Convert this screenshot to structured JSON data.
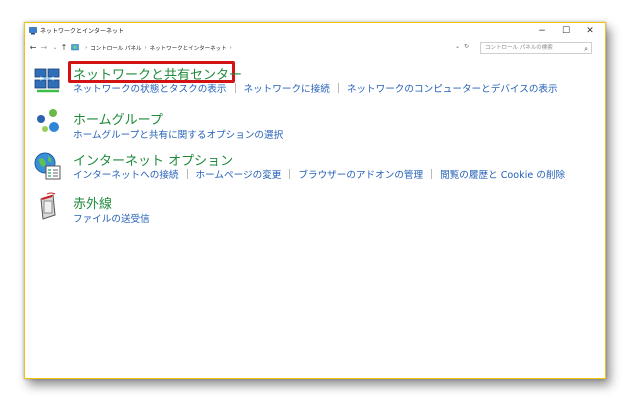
{
  "window": {
    "title": "ネットワークとインターネット",
    "controls": {
      "minimize": "−",
      "maximize": "☐",
      "close": "✕"
    }
  },
  "address": {
    "nav": {
      "back": "←",
      "forward": "→",
      "recent": "⌄",
      "up": "↑"
    },
    "breadcrumbs": [
      "コントロール パネル",
      "ネットワークとインターネット"
    ],
    "separator": "›",
    "search_placeholder": "コントロール パネルの検索"
  },
  "categories": [
    {
      "title": "ネットワークと共有センター",
      "icon": "network-sharing-center-icon",
      "links": [
        "ネットワークの状態とタスクの表示",
        "ネットワークに接続",
        "ネットワークのコンピューターとデバイスの表示"
      ]
    },
    {
      "title": "ホームグループ",
      "icon": "homegroup-icon",
      "links": [
        "ホームグループと共有に関するオプションの選択"
      ]
    },
    {
      "title": "インターネット オプション",
      "icon": "internet-options-icon",
      "links": [
        "インターネットへの接続",
        "ホームページの変更",
        "ブラウザーのアドオンの管理",
        "閲覧の履歴と Cookie の削除"
      ]
    },
    {
      "title": "赤外線",
      "icon": "infrared-icon",
      "links": [
        "ファイルの送受信"
      ]
    }
  ],
  "colors": {
    "category_title": "#1e8a3a",
    "link": "#2561b8",
    "highlight": "#d31313",
    "window_border": "#f1c40f"
  }
}
